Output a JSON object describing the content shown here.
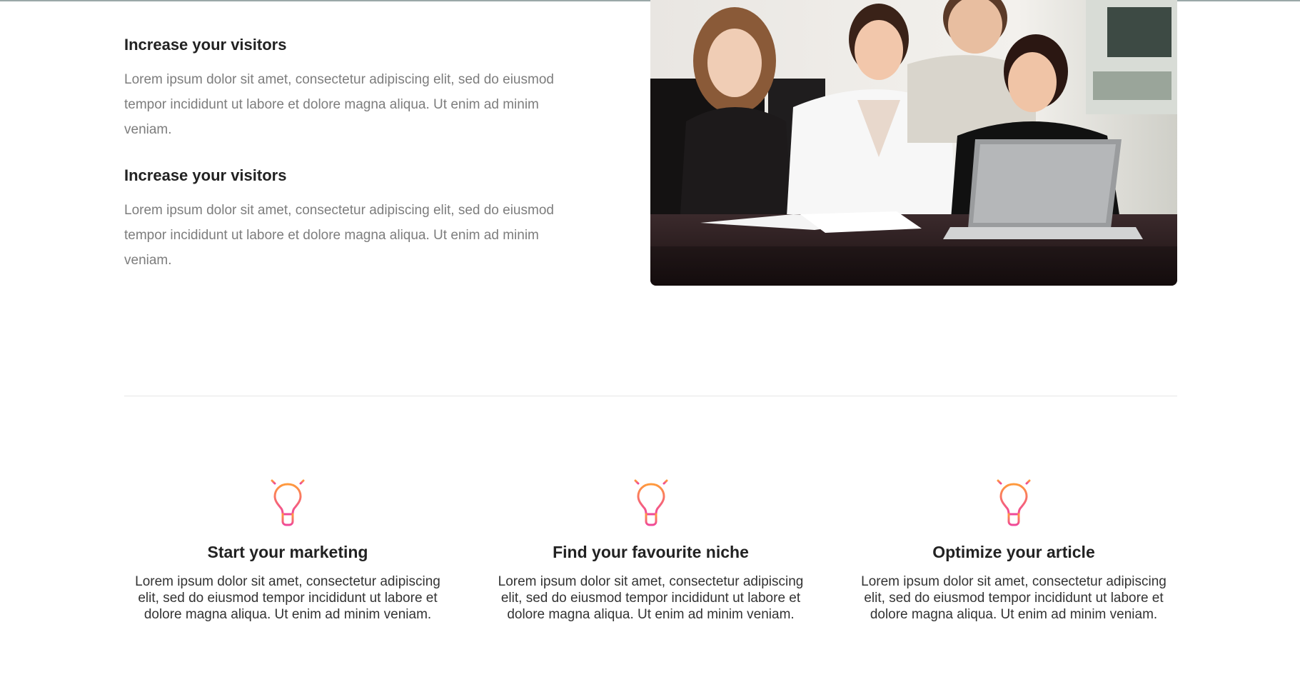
{
  "features": [
    {
      "title": "Increase your visitors",
      "text": "Lorem ipsum dolor sit amet, consectetur adipiscing elit, sed do eiusmod tempor incididunt ut labore et dolore magna aliqua. Ut enim ad minim veniam."
    },
    {
      "title": "Increase your visitors",
      "text": "Lorem ipsum dolor sit amet, consectetur adipiscing elit, sed do eiusmod tempor incididunt ut labore et dolore magna aliqua. Ut enim ad minim veniam."
    }
  ],
  "photo": {
    "icon": "team-meeting-photo"
  },
  "services": [
    {
      "icon": "lightbulb-icon",
      "title": "Start your marketing",
      "text": "Lorem ipsum dolor sit amet, consectetur adipiscing elit, sed do eiusmod tempor incididunt ut labore et dolore magna aliqua. Ut enim ad minim veniam."
    },
    {
      "icon": "lightbulb-icon",
      "title": "Find your favourite niche",
      "text": "Lorem ipsum dolor sit amet, consectetur adipiscing elit, sed do eiusmod tempor incididunt ut labore et dolore magna aliqua. Ut enim ad minim veniam."
    },
    {
      "icon": "lightbulb-icon",
      "title": "Optimize your article",
      "text": "Lorem ipsum dolor sit amet, consectetur adipiscing elit, sed do eiusmod tempor incididunt ut labore et dolore magna aliqua. Ut enim ad minim veniam."
    }
  ],
  "colors": {
    "icon_gradient_start": "#ff9a3c",
    "icon_gradient_end": "#f0479a"
  }
}
